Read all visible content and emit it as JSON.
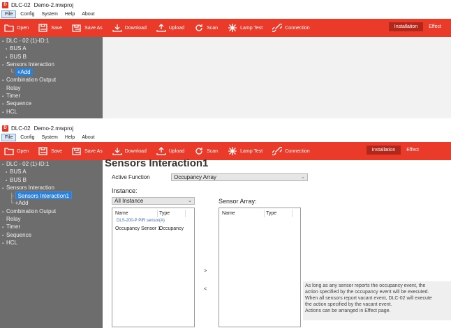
{
  "app": {
    "icon_text": "D",
    "product": "DLC-02",
    "file": "Demo-2.mwproj"
  },
  "menu": [
    "File",
    "Config",
    "System",
    "Help",
    "About"
  ],
  "toolbar": {
    "open": "Open",
    "save": "Save",
    "save_as": "Save As",
    "download": "Download",
    "upload": "Upload",
    "scan": "Scan",
    "lamp_test": "Lamp Test",
    "connection": "Connection",
    "installation": "Installation",
    "effect": "Effect"
  },
  "tree1": {
    "root": "DLC - 02 (1)-ID:1",
    "bus_a": "BUS A",
    "bus_b": "BUS B",
    "sensors": "Sensors Interaction",
    "add": "+Add",
    "combination": "Combination Output",
    "relay": "Relay",
    "timer": "Timer",
    "sequence": "Sequence",
    "hcl": "HCL"
  },
  "tree2": {
    "root": "DLC - 02 (1)-ID:1",
    "bus_a": "BUS A",
    "bus_b": "BUS B",
    "sensors": "Sensors Interaction",
    "sensors_child": "Sensors Interaction1",
    "add": "+Add",
    "combination": "Combination Output",
    "relay": "Relay",
    "timer": "Timer",
    "sequence": "Sequence",
    "hcl": "HCL"
  },
  "detail": {
    "title": "Sensors Interaction1",
    "active_function_label": "Active Function",
    "active_function_value": "Occupancy Array",
    "instance_label": "Instance:",
    "instance_value": "All Instance",
    "sensor_array_label": "Sensor Array:",
    "col_name": "Name",
    "col_type": "Type",
    "group": "DLS-200-P PIR sensor(A)",
    "rows": [
      {
        "name": "Occupancy Sensor 1",
        "type": "Occupancy"
      }
    ],
    "add_arrow": ">",
    "remove_arrow": "<",
    "info": [
      "As long as any sensor reports the occupancy event, the",
      "action specified by the occupancy event will be executed.",
      "When all sensors report vacant event, DLC-02 will execute",
      "the action specified by the vacant event.",
      "Actions can be arranged in Effect page."
    ]
  },
  "colors": {
    "toolbar": "#ea3a2a",
    "tree_bg": "#6d6d6d",
    "selection": "#2a7fd8"
  }
}
